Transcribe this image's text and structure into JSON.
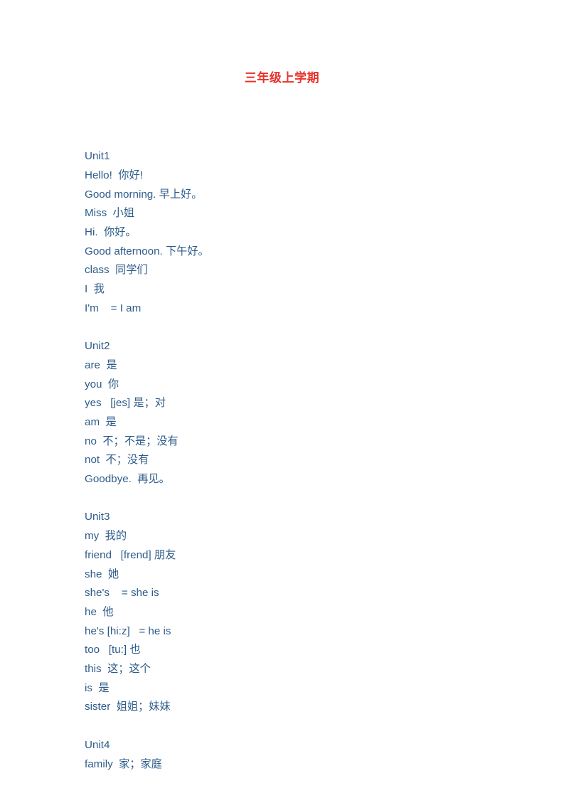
{
  "document": {
    "title": "三年级上学期",
    "title_color": "#E8322A",
    "body_color": "#2E5C8A",
    "page_background": "#ffffff"
  },
  "units": [
    {
      "heading": "Unit1",
      "lines": [
        "Hello!  你好!",
        "Good morning. 早上好。",
        "Miss  小姐",
        "Hi.  你好。",
        "Good afternoon. 下午好。",
        "class  同学们",
        "I  我",
        "I'm    = I am"
      ]
    },
    {
      "heading": "Unit2",
      "lines": [
        "are  是",
        "you  你",
        "yes   [jes] 是；对",
        "am  是",
        "no  不；不是；没有",
        "not  不；没有",
        "Goodbye.  再见。"
      ]
    },
    {
      "heading": "Unit3",
      "lines": [
        "my  我的",
        "friend   [frend] 朋友",
        "she  她",
        "she's    = she is",
        "he  他",
        "he's [hi:z]   = he is",
        "too   [tu:] 也",
        "this  这；这个",
        "is  是",
        "sister  姐姐；妹妹"
      ]
    },
    {
      "heading": "Unit4",
      "lines": [
        "family  家；家庭"
      ]
    }
  ]
}
